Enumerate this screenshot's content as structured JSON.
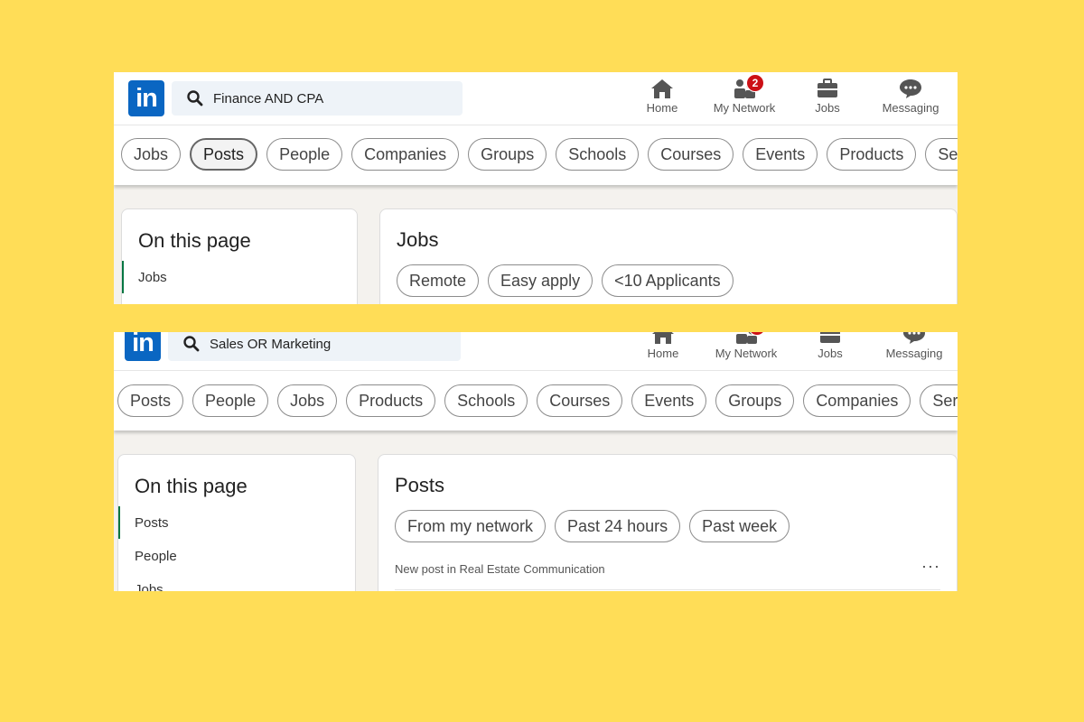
{
  "screenshot_top": {
    "search": {
      "query": "Finance AND CPA"
    },
    "nav": [
      {
        "label": "Home",
        "icon": "home-icon"
      },
      {
        "label": "My Network",
        "icon": "network-icon",
        "badge": "2"
      },
      {
        "label": "Jobs",
        "icon": "briefcase-icon"
      },
      {
        "label": "Messaging",
        "icon": "messaging-icon"
      }
    ],
    "filters": [
      "Jobs",
      "Posts",
      "People",
      "Companies",
      "Groups",
      "Schools",
      "Courses",
      "Events",
      "Products",
      "Services"
    ],
    "active_filter": "Posts",
    "sidebar": {
      "title": "On this page",
      "items": [
        "Jobs"
      ]
    },
    "main": {
      "title": "Jobs",
      "pills": [
        "Remote",
        "Easy apply",
        "<10 Applicants"
      ]
    }
  },
  "screenshot_bottom": {
    "search": {
      "query": "Sales OR Marketing"
    },
    "nav": [
      {
        "label": "Home",
        "icon": "home-icon"
      },
      {
        "label": "My Network",
        "icon": "network-icon"
      },
      {
        "label": "Jobs",
        "icon": "briefcase-icon"
      },
      {
        "label": "Messaging",
        "icon": "messaging-icon"
      }
    ],
    "filters": [
      "Posts",
      "People",
      "Jobs",
      "Products",
      "Schools",
      "Courses",
      "Events",
      "Groups",
      "Companies",
      "Services"
    ],
    "sidebar": {
      "title": "On this page",
      "items": [
        "Posts",
        "People",
        "Jobs"
      ]
    },
    "main": {
      "title": "Posts",
      "pills": [
        "From my network",
        "Past 24 hours",
        "Past week"
      ],
      "post_meta": "New post in Real Estate Communication",
      "more_label": "···"
    }
  },
  "colors": {
    "background": "#FFDD57",
    "brand": "#0A66C2",
    "badge": "#CC1016",
    "active_marker": "#057642"
  }
}
